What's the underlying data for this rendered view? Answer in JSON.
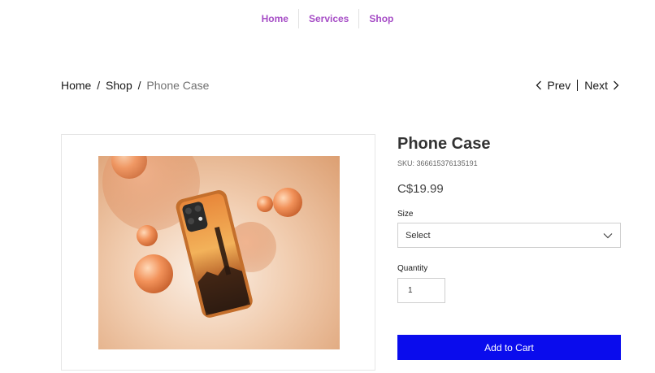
{
  "nav": {
    "items": [
      "Home",
      "Services",
      "Shop"
    ]
  },
  "breadcrumb": {
    "home": "Home",
    "separator": "/",
    "shop": "Shop",
    "current": "Phone Case"
  },
  "pager": {
    "prev": "Prev",
    "next": "Next"
  },
  "product": {
    "title": "Phone Case",
    "sku": "SKU: 366615376135191",
    "price": "C$19.99",
    "size_label": "Size",
    "size_value": "Select",
    "quantity_label": "Quantity",
    "quantity_value": "1",
    "add_to_cart": "Add to Cart"
  },
  "colors": {
    "nav_link": "#a64dc6",
    "add_to_cart_bg": "#0a0ced"
  },
  "icons": {
    "prev": "chevron-left-icon",
    "next": "chevron-right-icon",
    "select": "chevron-down-icon"
  }
}
